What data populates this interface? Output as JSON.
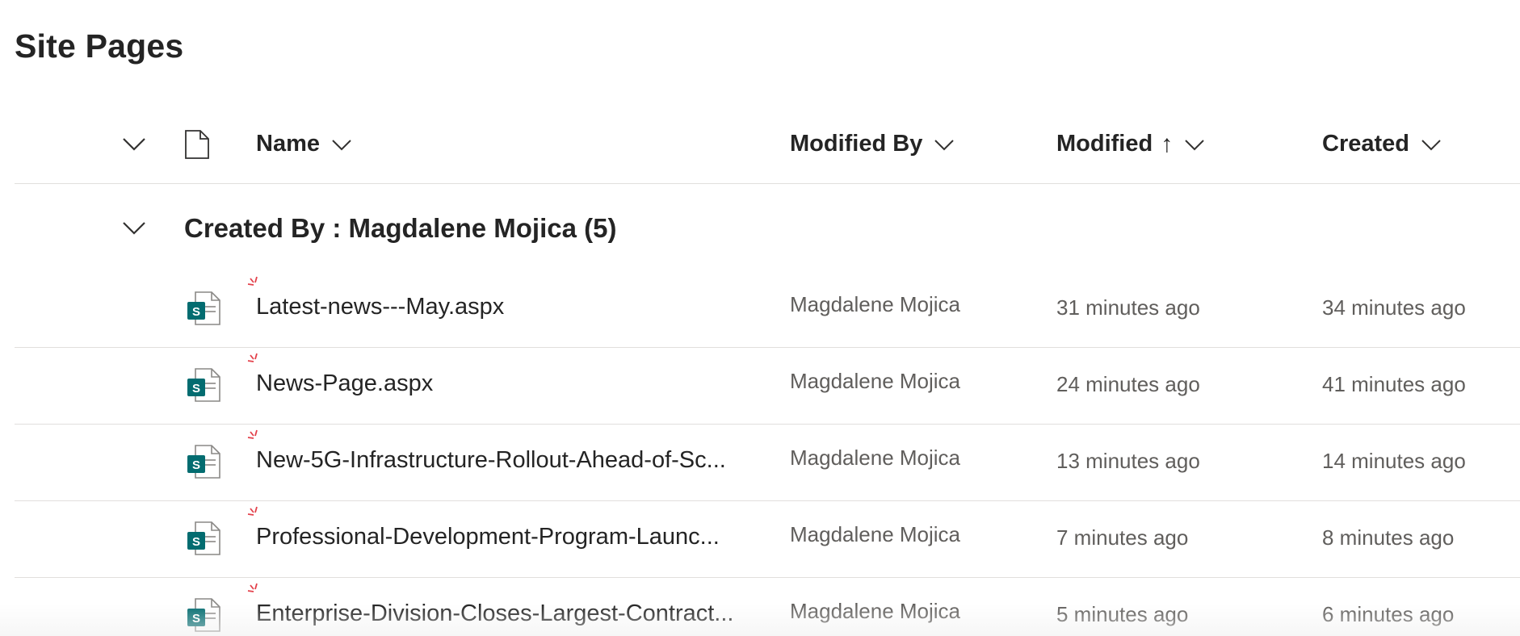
{
  "page": {
    "title": "Site Pages"
  },
  "header": {
    "select_all_icon": "chevron-down-icon",
    "file_type_icon": "document-icon",
    "name_label": "Name",
    "modified_by_label": "Modified By",
    "modified_label": "Modified",
    "modified_sort_arrow": "↑",
    "created_label": "Created"
  },
  "group": {
    "label": "Created By : Magdalene Mojica (5)"
  },
  "rows": [
    {
      "name": "Latest-news---May.aspx",
      "modified_by": "Magdalene Mojica",
      "modified": "31 minutes ago",
      "created": "34 minutes ago"
    },
    {
      "name": "News-Page.aspx",
      "modified_by": "Magdalene Mojica",
      "modified": "24 minutes ago",
      "created": "41 minutes ago"
    },
    {
      "name": "New-5G-Infrastructure-Rollout-Ahead-of-Sc...",
      "modified_by": "Magdalene Mojica",
      "modified": "13 minutes ago",
      "created": "14 minutes ago"
    },
    {
      "name": "Professional-Development-Program-Launc...",
      "modified_by": "Magdalene Mojica",
      "modified": "7 minutes ago",
      "created": "8 minutes ago"
    },
    {
      "name": "Enterprise-Division-Closes-Largest-Contract...",
      "modified_by": "Magdalene Mojica",
      "modified": "5 minutes ago",
      "created": "6 minutes ago"
    }
  ],
  "colors": {
    "text_primary": "#242424",
    "text_secondary": "#605e5c",
    "divider": "#e1dfdd",
    "sharepoint_teal": "#036c70",
    "new_mark_red": "#e3414b"
  }
}
